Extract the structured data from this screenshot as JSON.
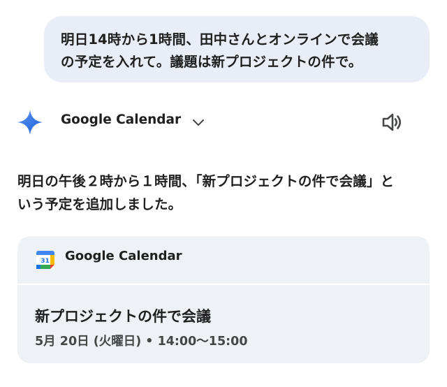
{
  "user_message": {
    "line1": "明日14時から1時間、田中さんとオンラインで会議",
    "line2": "の予定を入れて。議題は新プロジェクトの件で。"
  },
  "assistant": {
    "source_icon": "sparkle-icon",
    "source_name": "Google Calendar",
    "expand_icon": "chevron-down-icon",
    "audio_icon": "speaker-icon",
    "response_line1": "明日の午後２時から１時間、「新プロジェクトの件で会議」と",
    "response_line2": "いう予定を追加しました。"
  },
  "event_card": {
    "app_icon": "google-calendar-icon",
    "app_icon_text": "31",
    "app_name": "Google Calendar",
    "event_title": "新プロジェクトの件で会議",
    "event_datetime": "5月 20日 (火曜日) • 14:00～15:00"
  },
  "colors": {
    "user_bubble": "#e9eef6",
    "card_background": "#eef2f7",
    "sparkle_start": "#4285f4",
    "sparkle_end": "#1a73e8",
    "text_primary": "#1f1f1f",
    "text_secondary": "#444746"
  }
}
